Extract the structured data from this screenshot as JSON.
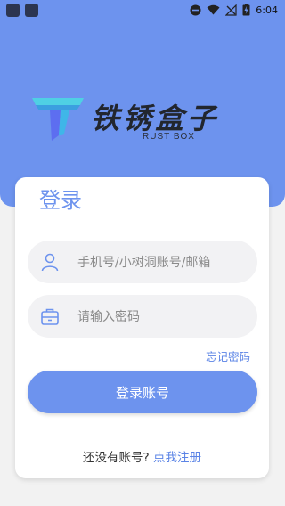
{
  "status_bar": {
    "time": "6:04",
    "icons": [
      "app-icon",
      "app-icon",
      "dnd-icon",
      "wifi-icon",
      "no-signal-icon",
      "battery-charging-icon"
    ]
  },
  "brand": {
    "name_cn": "铁锈盒子",
    "name_en": "RUST BOX"
  },
  "login": {
    "title": "登录",
    "phone_placeholder": "手机号/小树洞账号/邮箱",
    "password_placeholder": "请输入密码",
    "forgot_label": "忘记密码",
    "submit_label": "登录账号",
    "no_account_text": "还没有账号?",
    "register_link": "点我注册"
  },
  "colors": {
    "accent": "#6d93ee",
    "link": "#5b84e6",
    "field_bg": "#f2f2f4",
    "page_bg": "#f2f2f2"
  }
}
